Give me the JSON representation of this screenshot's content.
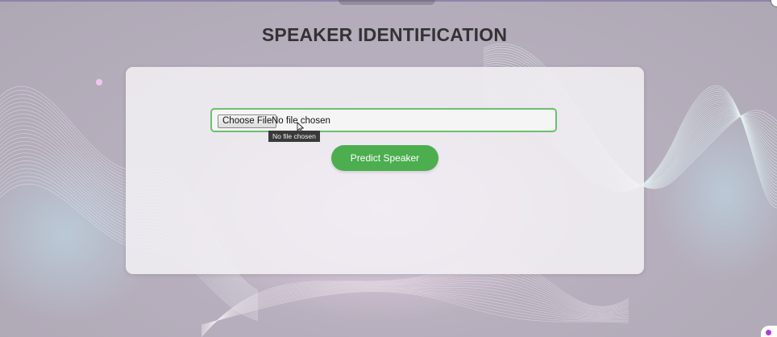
{
  "page": {
    "title": "SPEAKER IDENTIFICATION"
  },
  "upload": {
    "button_label": "Choose File",
    "status_text": "No file chosen",
    "tooltip_text": "No file chosen"
  },
  "actions": {
    "predict_label": "Predict Speaker"
  },
  "colors": {
    "accent_green": "#4cae4f",
    "field_border": "#6cc06f",
    "title_text": "#343236"
  },
  "icons": {
    "cursor": "cursor-icon",
    "background": "wave-lines-icon"
  }
}
